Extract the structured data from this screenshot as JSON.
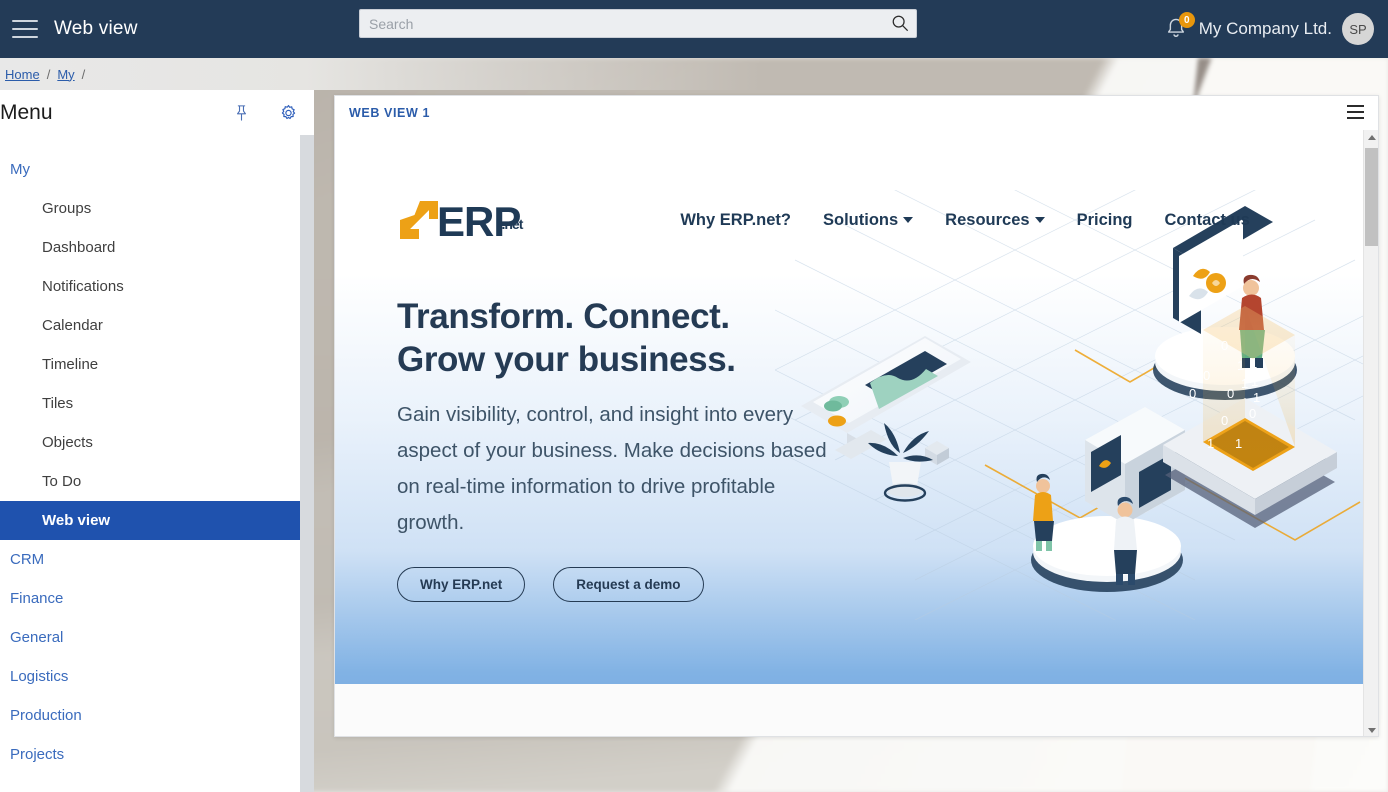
{
  "navbar": {
    "menu_icon": "hamburger-icon",
    "title": "Web view",
    "search": {
      "placeholder": "Search",
      "value": "",
      "icon": "search-icon"
    },
    "notifications": {
      "icon": "bell-icon",
      "count": "0",
      "badge_color": "#e8960c"
    },
    "company": "My Company Ltd.",
    "avatar_initials": "SP",
    "background_color": "#233b57"
  },
  "breadcrumb": {
    "items": [
      {
        "label": "Home"
      },
      {
        "label": "My"
      }
    ],
    "separator": "/"
  },
  "sidebar": {
    "title": "Menu",
    "pin_icon": "pin-icon",
    "settings_icon": "gear-icon",
    "items": [
      {
        "label": "My",
        "type": "group",
        "active": false
      },
      {
        "label": "Groups",
        "type": "item",
        "active": false
      },
      {
        "label": "Dashboard",
        "type": "item",
        "active": false
      },
      {
        "label": "Notifications",
        "type": "item",
        "active": false
      },
      {
        "label": "Calendar",
        "type": "item",
        "active": false
      },
      {
        "label": "Timeline",
        "type": "item",
        "active": false
      },
      {
        "label": "Tiles",
        "type": "item",
        "active": false
      },
      {
        "label": "Objects",
        "type": "item",
        "active": false
      },
      {
        "label": "To Do",
        "type": "item",
        "active": false
      },
      {
        "label": "Web view",
        "type": "item",
        "active": true
      },
      {
        "label": "CRM",
        "type": "group",
        "active": false
      },
      {
        "label": "Finance",
        "type": "group",
        "active": false
      },
      {
        "label": "General",
        "type": "group",
        "active": false
      },
      {
        "label": "Logistics",
        "type": "group",
        "active": false
      },
      {
        "label": "Production",
        "type": "group",
        "active": false
      },
      {
        "label": "Projects",
        "type": "group",
        "active": false
      }
    ],
    "active_color": "#1f52ae",
    "link_color": "#3a6bbd"
  },
  "web_panel": {
    "title": "WEB VIEW 1",
    "menu_icon": "hamburger-icon",
    "scrollbar": {
      "up_icon": "triangle-up-icon",
      "down_icon": "triangle-down-icon"
    }
  },
  "site": {
    "logo": {
      "text": "ERP",
      "suffix": ".net",
      "mark": "arrow-up-right-icon",
      "mark_color": "#eda116",
      "text_color": "#1f3a56"
    },
    "nav_links": [
      {
        "label": "Why ERP.net?",
        "dropdown": false
      },
      {
        "label": "Solutions",
        "dropdown": true
      },
      {
        "label": "Resources",
        "dropdown": true
      },
      {
        "label": "Pricing",
        "dropdown": false
      },
      {
        "label": "Contact us",
        "dropdown": false
      }
    ],
    "hero": {
      "heading_line1": "Transform. Connect.",
      "heading_line2": "Grow your business.",
      "paragraph": "Gain visibility, control, and insight into every aspect of your business. Make decisions based on real-time information to drive profitable growth.",
      "buttons": [
        {
          "label": "Why ERP.net"
        },
        {
          "label": "Request a demo"
        }
      ],
      "illustration": "isometric-business-network-illustration"
    }
  }
}
